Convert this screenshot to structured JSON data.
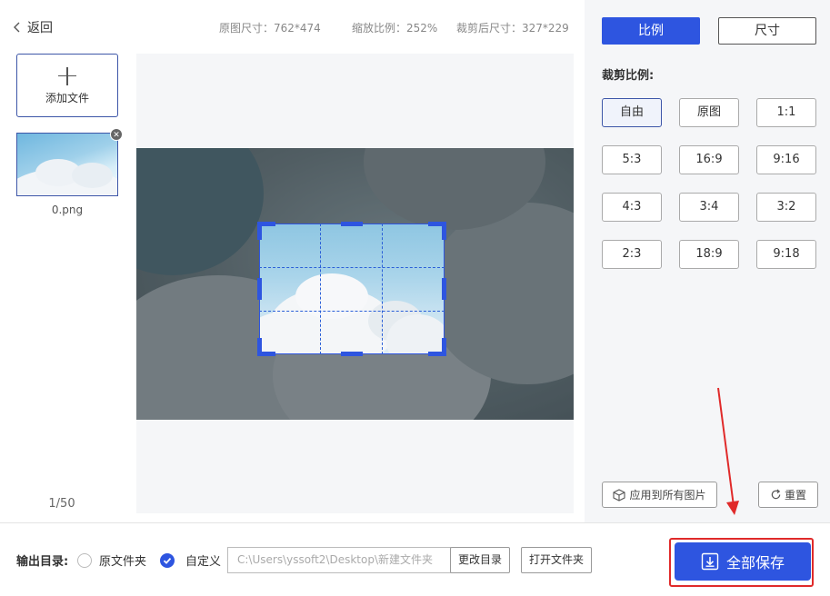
{
  "header": {
    "back_label": "返回",
    "original_size": "原图尺寸：762*474",
    "zoom_ratio": "缩放比例：252%",
    "cropped_size": "裁剪后尺寸：327*229"
  },
  "files": {
    "add_label": "添加文件",
    "items": [
      {
        "name": "0.png"
      }
    ],
    "pager": "1/50"
  },
  "sidebar": {
    "tabs": [
      {
        "label": "比例",
        "active": true
      },
      {
        "label": "尺寸",
        "active": false
      }
    ],
    "crop_title": "裁剪比例:",
    "ratios": [
      "自由",
      "原图",
      "1:1",
      "5:3",
      "16:9",
      "9:16",
      "4:3",
      "3:4",
      "3:2",
      "2:3",
      "18:9",
      "9:18"
    ],
    "selected_ratio": "自由",
    "apply_all_label": "应用到所有图片",
    "reset_label": "重置"
  },
  "output": {
    "label": "输出目录:",
    "option_original": "原文件夹",
    "option_custom": "自定义",
    "selected": "自定义",
    "path_value": "C:\\Users\\yssoft2\\Desktop\\新建文件夹",
    "change_dir_label": "更改目录",
    "open_folder_label": "打开文件夹",
    "save_all_label": "全部保存"
  },
  "colors": {
    "accent": "#2e55e0",
    "highlight": "#e02a2a"
  }
}
